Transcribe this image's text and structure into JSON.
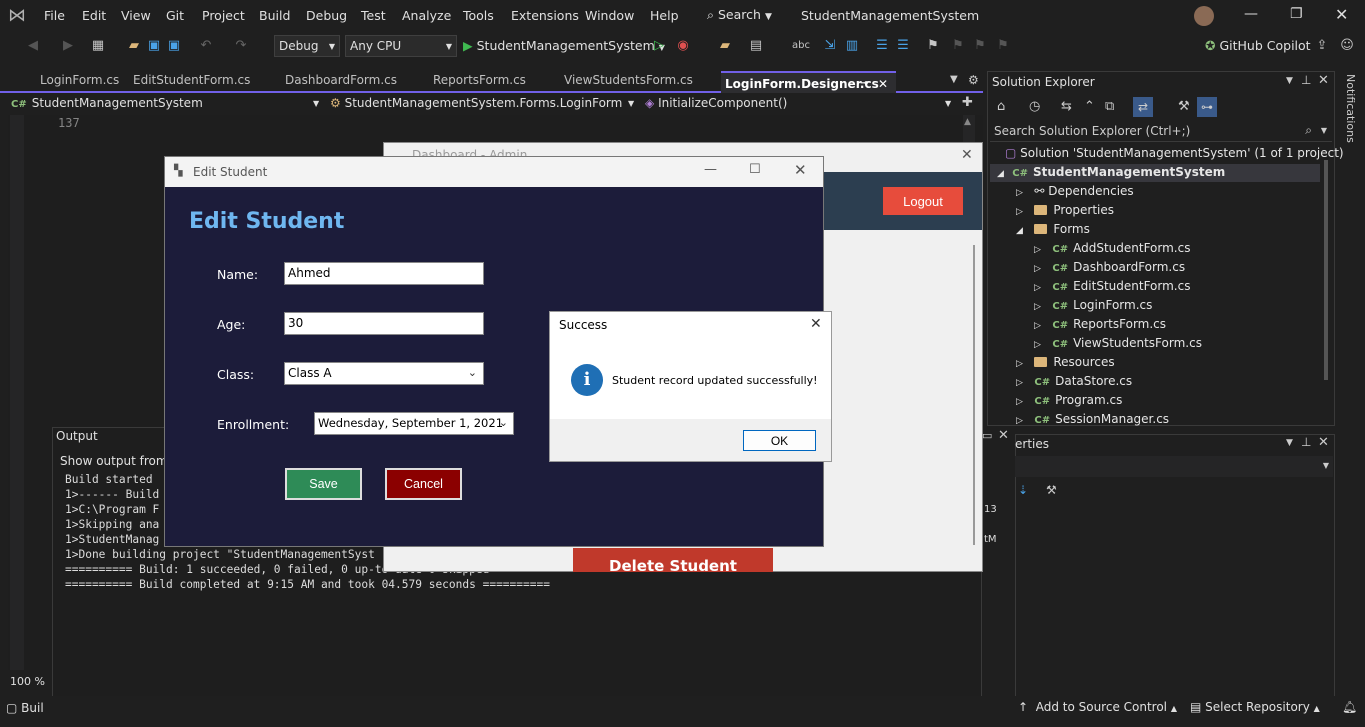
{
  "menu": [
    "File",
    "Edit",
    "View",
    "Git",
    "Project",
    "Build",
    "Debug",
    "Test",
    "Analyze",
    "Tools",
    "Extensions",
    "Window",
    "Help"
  ],
  "search_label": "Search",
  "solution_title": "StudentManagementSystem",
  "toolbar": {
    "config": "Debug",
    "platform": "Any CPU",
    "run_target": "StudentManagementSystem",
    "copilot": "GitHub Copilot"
  },
  "tabs": [
    "LoginForm.cs",
    "EditStudentForm.cs",
    "DashboardForm.cs",
    "ReportsForm.cs",
    "ViewStudentsForm.cs",
    "LoginForm.Designer.cs"
  ],
  "nav": {
    "project": "StudentManagementSystem",
    "class": "StudentManagementSystem.Forms.LoginForm",
    "member": "InitializeComponent()"
  },
  "editor": {
    "line_number": "137",
    "zoom": "100 %"
  },
  "output": {
    "title": "Output",
    "show_from": "Show output from:",
    "lines": [
      "Build started ",
      "1>------ Build",
      "1>C:\\Program F",
      "1>Skipping ana",
      "1>StudentManag",
      "1>Done building project \"StudentManagementSyst",
      "========== Build: 1 succeeded, 0 failed, 0 up-to-date 0 skipped ==========",
      "========== Build completed at 9:15 AM and took 04.579 seconds =========="
    ]
  },
  "solution_explorer": {
    "title": "Solution Explorer",
    "search": "Search Solution Explorer (Ctrl+;)",
    "solution": "Solution 'StudentManagementSystem' (1 of 1 project)",
    "project": "StudentManagementSystem",
    "items": [
      "Dependencies",
      "Properties",
      "Forms",
      "AddStudentForm.cs",
      "DashboardForm.cs",
      "EditStudentForm.cs",
      "LoginForm.cs",
      "ReportsForm.cs",
      "ViewStudentsForm.cs",
      "Resources",
      "DataStore.cs",
      "Program.cs",
      "SessionManager.cs"
    ]
  },
  "properties": {
    "title": "erties",
    "num1": "13",
    "txt2": "tM"
  },
  "notifications": "Notifications",
  "status": {
    "build": "Buil",
    "add_source": "Add to Source Control",
    "select_repo": "Select Repository"
  },
  "dashboard": {
    "title": "Dashboard - Admin",
    "logout": "Logout",
    "delete": "Delete Student"
  },
  "edit_form": {
    "title": "Edit Student",
    "heading": "Edit Student",
    "name_label": "Name:",
    "name_value": "Ahmed",
    "age_label": "Age:",
    "age_value": "30",
    "class_label": "Class:",
    "class_value": "Class A",
    "enroll_label": "Enrollment:",
    "enroll_value": "Wednesday, September  1, 2021",
    "save": "Save",
    "cancel": "Cancel"
  },
  "message": {
    "title": "Success",
    "text": "Student record updated successfully!",
    "ok": "OK"
  },
  "colors": {
    "accent": "#7160e8",
    "save": "#2e8b57",
    "cancel": "#8b0000",
    "logout": "#e74c3c",
    "heading": "#6fb7f0",
    "form_bg": "#1c1c3a"
  }
}
